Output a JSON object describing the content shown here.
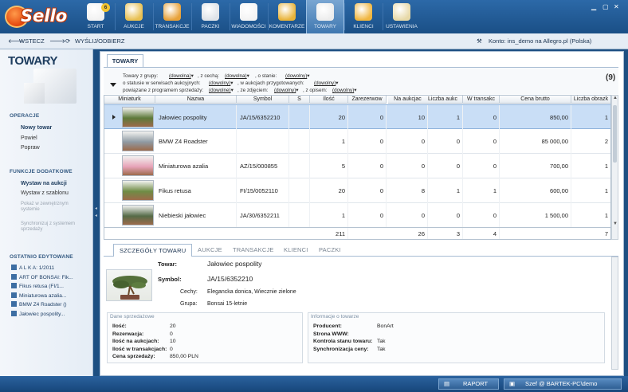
{
  "app": {
    "logo_text": "Sello"
  },
  "nav": [
    {
      "label": "START",
      "icon": "home-icon",
      "badge": "6"
    },
    {
      "label": "AUKCJE",
      "icon": "auction-hammer-icon"
    },
    {
      "label": "TRANSAKCJE",
      "icon": "transactions-icon"
    },
    {
      "label": "PACZKI",
      "icon": "package-icon"
    },
    {
      "label": "WIADOMOŚCI",
      "icon": "messages-icon"
    },
    {
      "label": "KOMENTARZE",
      "icon": "comments-icon"
    },
    {
      "label": "TOWARY",
      "icon": "products-icon",
      "active": true
    },
    {
      "label": "KLIENCI",
      "icon": "clients-icon"
    },
    {
      "label": "USTAWIENIA",
      "icon": "settings-icon"
    }
  ],
  "toolbar": {
    "back": "WSTECZ",
    "sync": "WYŚLIJ/ODBIERZ",
    "account": "Konto: ins_demo na Allegro.pl (Polska)"
  },
  "left_panel": {
    "title": "TOWARY",
    "operacje_label": "OPERACJE",
    "operacje": [
      "Nowy towar",
      "Powiel",
      "Popraw"
    ],
    "funkcje_label": "FUNKCJE DODATKOWE",
    "funkcje": [
      "Wystaw na aukcji",
      "Wystaw z szablonu",
      "Pokaż w zewnętrznym systemie",
      "Synchronizuj z systemem sprzedaży"
    ],
    "recent_label": "OSTATNIO EDYTOWANE",
    "recent": [
      "A L K A: 1/2011",
      "ART OF BONSAI: Fik...",
      "Fikus retusa (FI/1...",
      "Miniaturowa azalia...",
      "BMW Z4 Roadster ()",
      "Jałowiec pospolity..."
    ]
  },
  "main_tab": "TOWARY",
  "filters": {
    "l1a": "Towary z grupy:",
    "l1b": ", z cechą:",
    "l1c": ", o stanie:",
    "l2a": "o statusie w serwisach aukcyjnych:",
    "l2b": ", w aukcjach przygotowanych:",
    "l3a": "powiązane z programem sprzedaży:",
    "l3b": ", ze zdjęciem:",
    "l3c": ", z opisem:",
    "any": "(dowolna)",
    "any_m": "(dowolny)",
    "any_e": "(dowolne)",
    "count": "(9)"
  },
  "grid": {
    "columns": [
      "Miniaturk",
      "Nazwa",
      "Symbol",
      "S",
      "Ilość",
      "Zarezerwow",
      "Na aukcjac",
      "Liczba aukc",
      "W transakc",
      "Cena brutto",
      "Liczba obrazk"
    ],
    "rows": [
      {
        "name": "Jałowiec pospolity",
        "symbol": "JA/15/6352210",
        "s": "",
        "ilosc": "20",
        "zarez": "0",
        "aukcje": "10",
        "liczba": "1",
        "transakcje": "0",
        "cena": "850,00",
        "obrazki": "1",
        "thumb": "#5d7a3a"
      },
      {
        "name": "BMW Z4 Roadster",
        "symbol": "",
        "s": "",
        "ilosc": "1",
        "zarez": "0",
        "aukcje": "0",
        "liczba": "0",
        "transakcje": "0",
        "cena": "85 000,00",
        "obrazki": "2",
        "thumb": "#8f9aa3"
      },
      {
        "name": "Miniaturowa azalia",
        "symbol": "AZ/15/000855",
        "s": "",
        "ilosc": "5",
        "zarez": "0",
        "aukcje": "0",
        "liczba": "0",
        "transakcje": "0",
        "cena": "700,00",
        "obrazki": "1",
        "thumb": "#e7a3b8"
      },
      {
        "name": "Fikus retusa",
        "symbol": "FI/15/0052110",
        "s": "",
        "ilosc": "20",
        "zarez": "0",
        "aukcje": "8",
        "liczba": "1",
        "transakcje": "1",
        "cena": "600,00",
        "obrazki": "1",
        "thumb": "#6f8c45"
      },
      {
        "name": "Niebieski jałowiec",
        "symbol": "JA/30/6352211",
        "s": "",
        "ilosc": "1",
        "zarez": "0",
        "aukcje": "0",
        "liczba": "0",
        "transakcje": "0",
        "cena": "1 500,00",
        "obrazki": "1",
        "thumb": "#556b48"
      }
    ],
    "totals": {
      "ilosc": "211",
      "aukcje": "26",
      "liczba": "3",
      "transakcje": "4",
      "obrazki": "7"
    }
  },
  "bottom_tabs": [
    "SZCZEGÓŁY TOWARU",
    "AUKCJE",
    "TRANSAKCJE",
    "KLIENCI",
    "PACZKI"
  ],
  "details": {
    "towar_label": "Towar:",
    "towar": "Jałowiec pospolity",
    "symbol_label": "Symbol:",
    "symbol": "JA/15/6352210",
    "cechy_label": "Cechy:",
    "cechy": "Elegancka donica, Wiecznie zielone",
    "grupa_label": "Grupa:",
    "grupa": "Bonsai 15-letnie"
  },
  "sales": {
    "header": "Dane sprzedażowe",
    "rows": [
      {
        "k": "Ilość:",
        "v": "20"
      },
      {
        "k": "Rezerwacja:",
        "v": "0"
      },
      {
        "k": "Ilość na aukcjach:",
        "v": "10"
      },
      {
        "k": "Ilość w transakcjach:",
        "v": "0"
      },
      {
        "k": "Cena sprzedaży:",
        "v": "850,00 PLN"
      }
    ]
  },
  "info": {
    "header": "Informacje o towarze",
    "rows": [
      {
        "k": "Producent:",
        "v": "BonArt"
      },
      {
        "k": "Strona WWW:",
        "v": ""
      },
      {
        "k": "Kontrola stanu towaru:",
        "v": "Tak"
      },
      {
        "k": "Synchronizacja ceny:",
        "v": "Tak"
      }
    ]
  },
  "status": {
    "report": "RAPORT",
    "user": "Szef @ BARTEK-PC\\demo"
  }
}
